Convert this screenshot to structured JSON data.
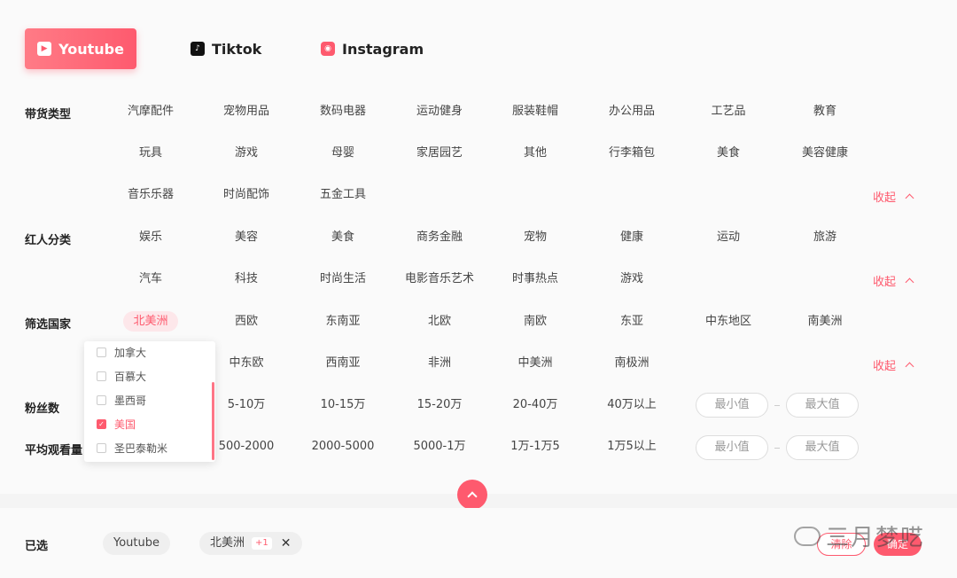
{
  "platforms": [
    {
      "label": "Youtube",
      "active": true
    },
    {
      "label": "Tiktok",
      "active": false
    },
    {
      "label": "Instagram",
      "active": false
    }
  ],
  "rows": {
    "goods_label": "带货类型",
    "goods": [
      "汽摩配件",
      "宠物用品",
      "数码电器",
      "运动健身",
      "服装鞋帽",
      "办公用品",
      "工艺品",
      "教育",
      "玩具",
      "游戏",
      "母婴",
      "家居园艺",
      "其他",
      "行李箱包",
      "美食",
      "美容健康",
      "音乐乐器",
      "时尚配饰",
      "五金工具"
    ],
    "influencer_label": "红人分类",
    "influencer": [
      "娱乐",
      "美容",
      "美食",
      "商务金融",
      "宠物",
      "健康",
      "运动",
      "旅游",
      "汽车",
      "科技",
      "时尚生活",
      "电影音乐艺术",
      "时事热点",
      "游戏"
    ],
    "country_label": "筛选国家",
    "countries": [
      "北美洲",
      "西欧",
      "东南亚",
      "北欧",
      "南欧",
      "东亚",
      "中东地区",
      "南美洲",
      "中东欧",
      "西南亚",
      "非洲",
      "中美洲",
      "南极洲"
    ],
    "fans_label": "粉丝数",
    "fans": [
      "5-10万",
      "10-15万",
      "15-20万",
      "20-40万",
      "40万以上"
    ],
    "views_label": "平均观看量",
    "views": [
      "500-2000",
      "2000-5000",
      "5000-1万",
      "1万-1万5",
      "1万5以上"
    ],
    "collapse_label": "收起",
    "min_placeholder": "最小值",
    "max_placeholder": "最大值"
  },
  "dropdown": {
    "items": [
      {
        "label": "加拿大",
        "checked": false
      },
      {
        "label": "百慕大",
        "checked": false
      },
      {
        "label": "墨西哥",
        "checked": false
      },
      {
        "label": "美国",
        "checked": true
      },
      {
        "label": "圣巴泰勒米",
        "checked": false
      }
    ]
  },
  "footer": {
    "selected_label": "已选",
    "tags": [
      {
        "label": "Youtube",
        "badge": ""
      },
      {
        "label": "北美洲",
        "badge": "+1"
      }
    ],
    "clear_label": "清除",
    "confirm_label": "确定",
    "watermark": "三月梦呓"
  },
  "colors": {
    "accent": "#fe5a6e"
  }
}
